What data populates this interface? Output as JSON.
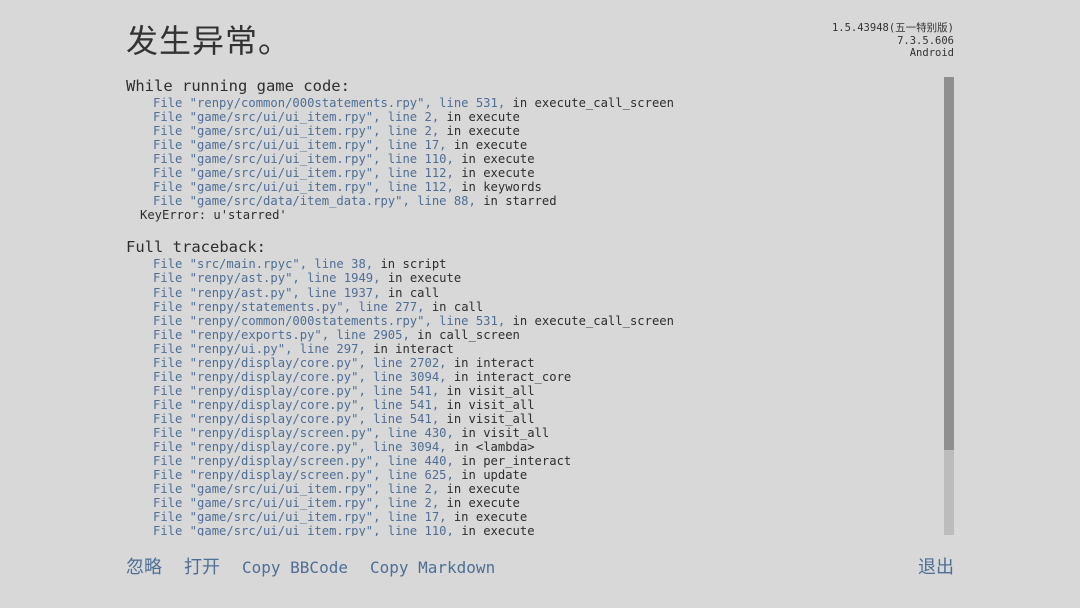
{
  "title": "发生异常。",
  "version": {
    "line1": "1.5.43948(五一特别版)",
    "line2": "7.3.5.606",
    "line3": "Android"
  },
  "game_code": {
    "heading": "While running game code:",
    "frames": [
      {
        "loc": "File \"renpy/common/000statements.rpy\", line 531,",
        "fn": "in execute_call_screen"
      },
      {
        "loc": "File \"game/src/ui/ui_item.rpy\", line 2,",
        "fn": "in execute"
      },
      {
        "loc": "File \"game/src/ui/ui_item.rpy\", line 2,",
        "fn": "in execute"
      },
      {
        "loc": "File \"game/src/ui/ui_item.rpy\", line 17,",
        "fn": "in execute"
      },
      {
        "loc": "File \"game/src/ui/ui_item.rpy\", line 110,",
        "fn": "in execute"
      },
      {
        "loc": "File \"game/src/ui/ui_item.rpy\", line 112,",
        "fn": "in execute"
      },
      {
        "loc": "File \"game/src/ui/ui_item.rpy\", line 112,",
        "fn": "in keywords"
      },
      {
        "loc": "File \"game/src/data/item_data.rpy\", line 88,",
        "fn": "in starred"
      }
    ],
    "error": "KeyError: u'starred'"
  },
  "full_traceback": {
    "heading": "Full traceback:",
    "frames": [
      {
        "loc": "File \"src/main.rpyc\", line 38,",
        "fn": "in script"
      },
      {
        "loc": "File \"renpy/ast.py\", line 1949,",
        "fn": "in execute"
      },
      {
        "loc": "File \"renpy/ast.py\", line 1937,",
        "fn": "in call"
      },
      {
        "loc": "File \"renpy/statements.py\", line 277,",
        "fn": "in call"
      },
      {
        "loc": "File \"renpy/common/000statements.rpy\", line 531,",
        "fn": "in execute_call_screen"
      },
      {
        "loc": "File \"renpy/exports.py\", line 2905,",
        "fn": "in call_screen"
      },
      {
        "loc": "File \"renpy/ui.py\", line 297,",
        "fn": "in interact"
      },
      {
        "loc": "File \"renpy/display/core.py\", line 2702,",
        "fn": "in interact"
      },
      {
        "loc": "File \"renpy/display/core.py\", line 3094,",
        "fn": "in interact_core"
      },
      {
        "loc": "File \"renpy/display/core.py\", line 541,",
        "fn": "in visit_all"
      },
      {
        "loc": "File \"renpy/display/core.py\", line 541,",
        "fn": "in visit_all"
      },
      {
        "loc": "File \"renpy/display/core.py\", line 541,",
        "fn": "in visit_all"
      },
      {
        "loc": "File \"renpy/display/screen.py\", line 430,",
        "fn": "in visit_all"
      },
      {
        "loc": "File \"renpy/display/core.py\", line 3094,",
        "fn": "in <lambda>"
      },
      {
        "loc": "File \"renpy/display/screen.py\", line 440,",
        "fn": "in per_interact"
      },
      {
        "loc": "File \"renpy/display/screen.py\", line 625,",
        "fn": "in update"
      },
      {
        "loc": "File \"game/src/ui/ui_item.rpy\", line 2,",
        "fn": "in execute"
      },
      {
        "loc": "File \"game/src/ui/ui_item.rpy\", line 2,",
        "fn": "in execute"
      },
      {
        "loc": "File \"game/src/ui/ui_item.rpy\", line 17,",
        "fn": "in execute"
      },
      {
        "loc": "File \"game/src/ui/ui_item.rpy\", line 110,",
        "fn": "in execute"
      }
    ]
  },
  "scroll": {
    "position": 0
  },
  "actions": {
    "ignore": "忽略",
    "open": "打开",
    "copy_bbcode": "Copy BBCode",
    "copy_markdown": "Copy Markdown",
    "exit": "退出"
  }
}
